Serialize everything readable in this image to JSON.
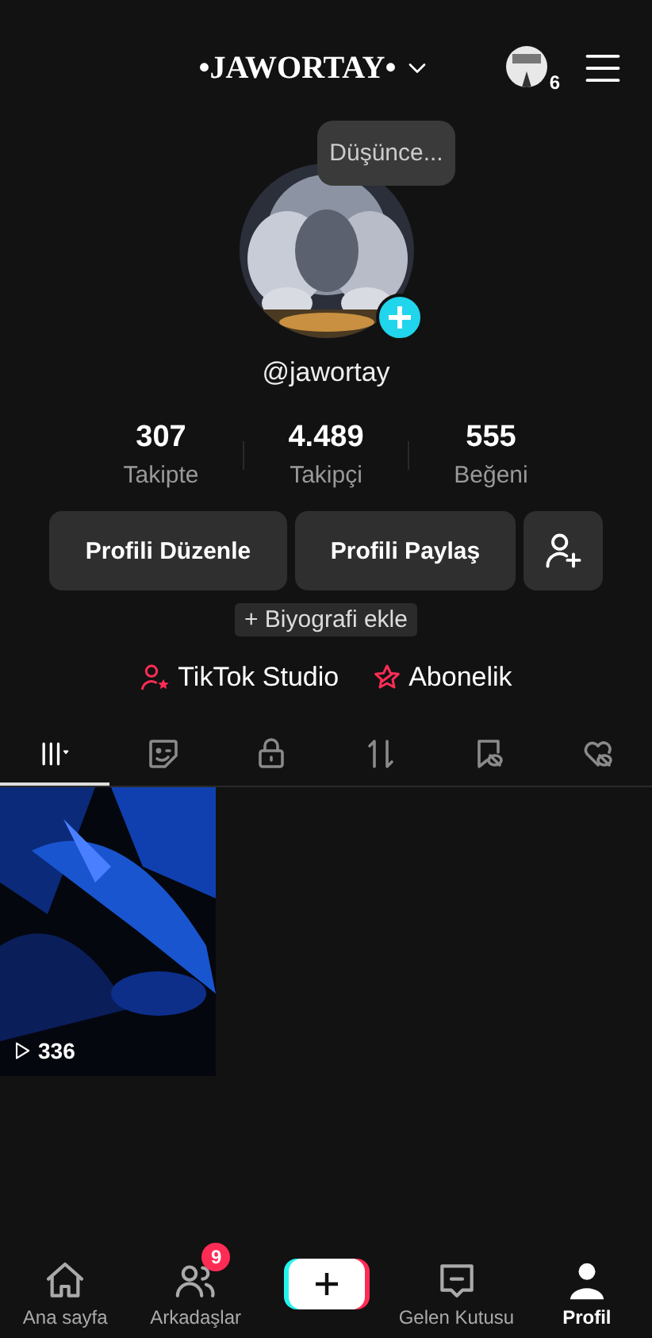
{
  "header": {
    "username": "•JAWORTAY•",
    "story_count": "6"
  },
  "profile": {
    "thought": "Düşünce...",
    "handle": "@jawortay"
  },
  "stats": [
    {
      "value": "307",
      "label": "Takipte"
    },
    {
      "value": "4.489",
      "label": "Takipçi"
    },
    {
      "value": "555",
      "label": "Beğeni"
    }
  ],
  "actions": [
    "Profili Düzenle",
    "Profili Paylaş"
  ],
  "bio_button": "+ Biyografi ekle",
  "links": [
    {
      "kind": "studio",
      "label": "TikTok Studio"
    },
    {
      "kind": "subscription",
      "label": "Abonelik"
    }
  ],
  "tabs": [
    {
      "kind": "grid",
      "selected": true
    },
    {
      "kind": "sticker",
      "selected": false
    },
    {
      "kind": "lock",
      "selected": false
    },
    {
      "kind": "repost",
      "selected": false
    },
    {
      "kind": "bookmark",
      "selected": false
    },
    {
      "kind": "liked",
      "selected": false
    }
  ],
  "videos": [
    {
      "views": "336"
    }
  ],
  "nav": [
    {
      "kind": "home",
      "label": "Ana sayfa",
      "selected": false
    },
    {
      "kind": "friends",
      "label": "Arkadaşlar",
      "selected": false,
      "badge": "9"
    },
    {
      "kind": "create",
      "selected": false
    },
    {
      "kind": "inbox",
      "label": "Gelen Kutusu",
      "selected": false
    },
    {
      "kind": "profile",
      "label": "Profil",
      "selected": true
    }
  ]
}
